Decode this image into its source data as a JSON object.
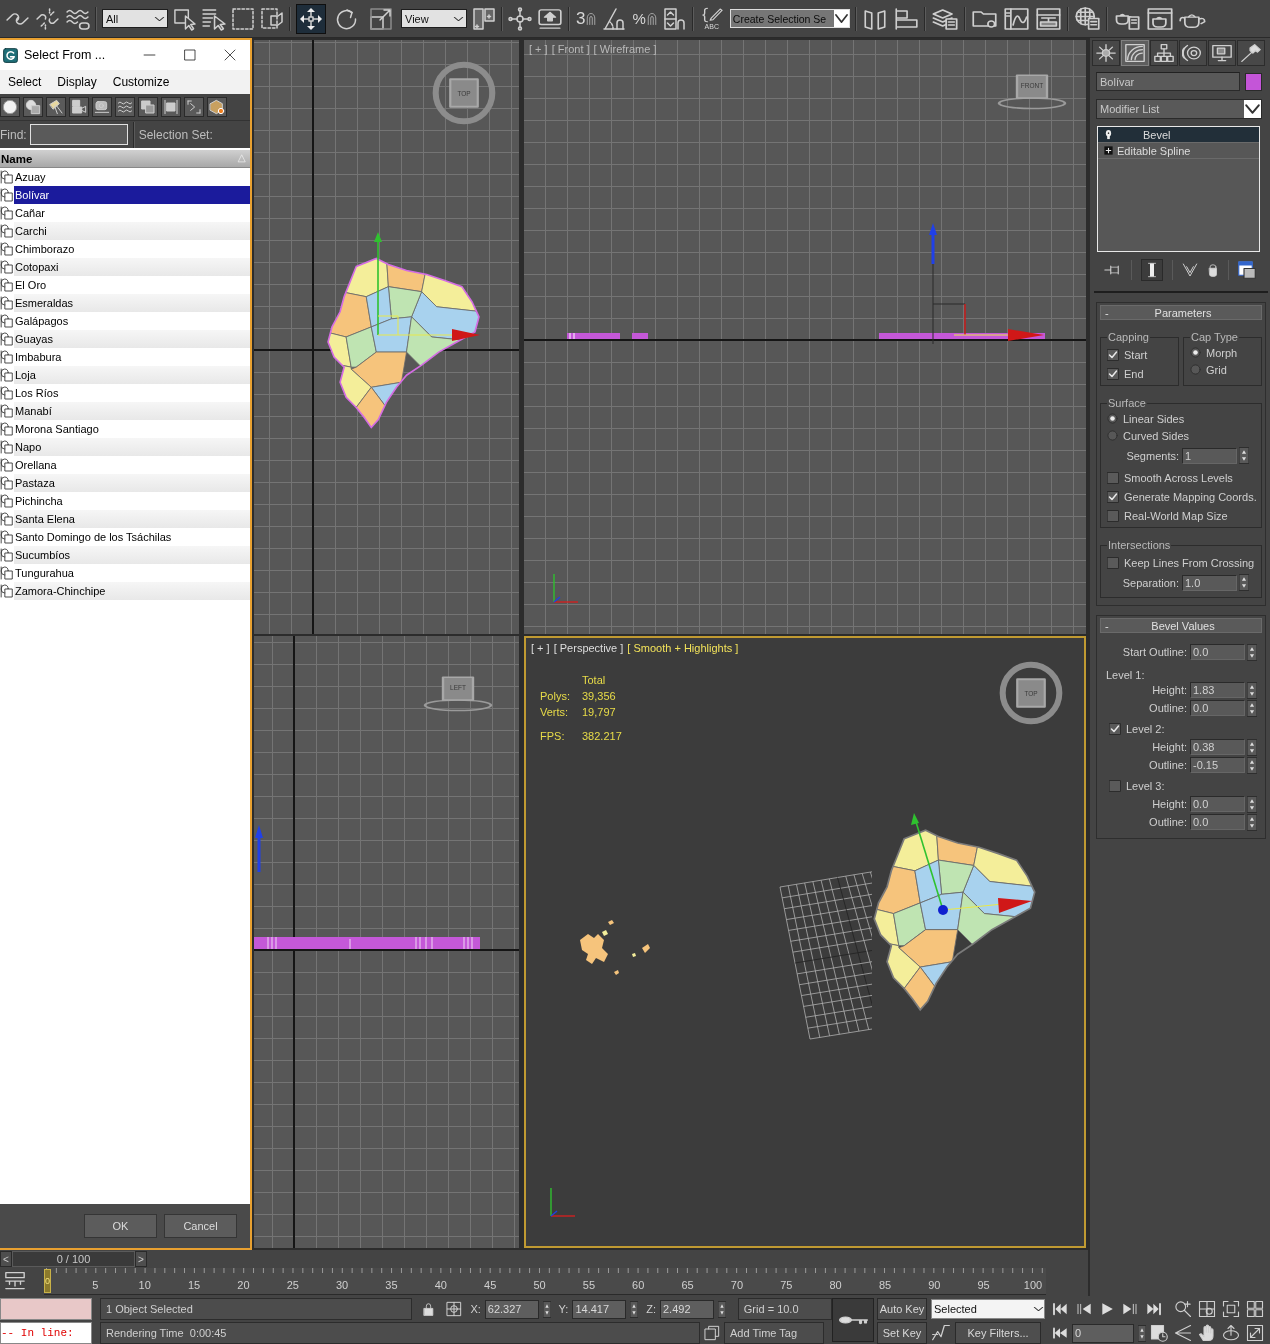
{
  "toolbar": {
    "selection_filter": "All",
    "transform_tools": [
      {
        "selected": true
      },
      {
        "selected": false
      },
      {
        "selected": false
      }
    ],
    "reference_coordinate_system": "View",
    "snaps_toggle_label": "3",
    "percent_snap_label": "%",
    "named_sets_label": "ABC",
    "named_selection_set": "Create Selection Se"
  },
  "dialog": {
    "title": "Select From ...",
    "menu": [
      "Select",
      "Display",
      "Customize"
    ],
    "find_label": "Find:",
    "selection_set_label": "Selection Set:",
    "column": "Name",
    "items": [
      {
        "name": "Azuay",
        "selected": false
      },
      {
        "name": "Bolívar",
        "selected": true
      },
      {
        "name": "Cañar",
        "selected": false
      },
      {
        "name": "Carchi",
        "selected": false
      },
      {
        "name": "Chimborazo",
        "selected": false
      },
      {
        "name": "Cotopaxi",
        "selected": false
      },
      {
        "name": "El Oro",
        "selected": false
      },
      {
        "name": "Esmeraldas",
        "selected": false
      },
      {
        "name": "Galápagos",
        "selected": false
      },
      {
        "name": "Guayas",
        "selected": false
      },
      {
        "name": "Imbabura",
        "selected": false
      },
      {
        "name": "Loja",
        "selected": false
      },
      {
        "name": "Los Ríos",
        "selected": false
      },
      {
        "name": "Manabí",
        "selected": false
      },
      {
        "name": "Morona Santiago",
        "selected": false
      },
      {
        "name": "Napo",
        "selected": false
      },
      {
        "name": "Orellana",
        "selected": false
      },
      {
        "name": "Pastaza",
        "selected": false
      },
      {
        "name": "Pichincha",
        "selected": false
      },
      {
        "name": "Santa Elena",
        "selected": false
      },
      {
        "name": "Santo Domingo de los Tsáchilas",
        "selected": false
      },
      {
        "name": "Sucumbíos",
        "selected": false
      },
      {
        "name": "Tungurahua",
        "selected": false
      },
      {
        "name": "Zamora-Chinchipe",
        "selected": false
      }
    ],
    "buttons": [
      "OK",
      "Cancel"
    ]
  },
  "viewports": [
    {
      "kind": "top",
      "active": false,
      "view_cube": "TOP"
    },
    {
      "kind": "front",
      "active": false,
      "label": [
        {
          "text": "[ + ]",
          "highlighted": false
        },
        {
          "text": "[ Front ]",
          "highlighted": false
        },
        {
          "text": "[ Wireframe ]",
          "highlighted": false
        }
      ],
      "view_cube": "FRONT"
    },
    {
      "kind": "left",
      "active": false,
      "view_cube": "LEFT"
    },
    {
      "kind": "perspective",
      "active": true,
      "label": [
        {
          "text": "[ + ]",
          "highlighted": false
        },
        {
          "text": "[ Perspective ]",
          "highlighted": false
        },
        {
          "text": "[ Smooth + Highlights ]",
          "highlighted": true
        }
      ],
      "view_cube": "TOP",
      "stats": {
        "header": "Total",
        "rows": [
          {
            "label": "Polys:",
            "value": "39,356"
          },
          {
            "label": "Verts:",
            "value": "19,797"
          }
        ],
        "fps_label": "FPS:",
        "fps": "382.217"
      }
    }
  ],
  "command_panel": {
    "tabs": [
      {
        "selected": false
      },
      {
        "selected": true
      },
      {
        "selected": false
      },
      {
        "selected": false
      },
      {
        "selected": false
      },
      {
        "selected": false
      }
    ],
    "object_name": "Bolívar",
    "modifier_list": "Modifier List",
    "stack": [
      {
        "name": "Bevel",
        "kind": "modifier",
        "selected": true
      },
      {
        "name": "Editable Spline",
        "kind": "base",
        "selected": false
      }
    ],
    "show_end_result": true,
    "rollouts": [
      {
        "toggle": "-",
        "title": "Parameters",
        "group_rows": [
          {
            "groups": [
              {
                "title": "Capping",
                "rows": [
                  {
                    "kind": "checkbox",
                    "label": "Start",
                    "checked": true
                  },
                  {
                    "kind": "checkbox",
                    "label": "End",
                    "checked": true
                  }
                ]
              },
              {
                "title": "Cap Type",
                "rows": [
                  {
                    "kind": "radio",
                    "label": "Morph",
                    "selected": true
                  },
                  {
                    "kind": "radio",
                    "label": "Grid",
                    "selected": false
                  }
                ]
              }
            ]
          },
          {
            "groups": [
              {
                "title": "Surface",
                "rows": [
                  {
                    "kind": "radio",
                    "label": "Linear Sides",
                    "selected": true
                  },
                  {
                    "kind": "radio",
                    "label": "Curved Sides",
                    "selected": false
                  },
                  {
                    "kind": "spinner",
                    "label": "Segments:",
                    "value": "1"
                  },
                  {
                    "kind": "checkbox",
                    "label": "Smooth Across Levels",
                    "checked": false
                  },
                  {
                    "kind": "checkbox",
                    "label": "Generate Mapping Coords.",
                    "checked": true
                  },
                  {
                    "kind": "checkbox",
                    "label": "Real-World Map Size",
                    "checked": false
                  }
                ]
              }
            ]
          },
          {
            "groups": [
              {
                "title": "Intersections",
                "rows": [
                  {
                    "kind": "checkbox",
                    "label": "Keep Lines From Crossing",
                    "checked": false
                  },
                  {
                    "kind": "spinner",
                    "label": "Separation:",
                    "value": "1.0"
                  }
                ]
              }
            ]
          }
        ]
      },
      {
        "toggle": "-",
        "title": "Bevel Values",
        "rows": [
          {
            "kind": "spinner",
            "label": "Start Outline:",
            "value": "0.0"
          },
          {
            "kind": "label",
            "label": "Level 1:"
          },
          {
            "kind": "spinner",
            "label": "Height:",
            "value": "1.83"
          },
          {
            "kind": "spinner",
            "label": "Outline:",
            "value": "0.0"
          },
          {
            "kind": "checkbox",
            "label": "Level 2:",
            "checked": true
          },
          {
            "kind": "spinner",
            "label": "Height:",
            "value": "0.38"
          },
          {
            "kind": "spinner",
            "label": "Outline:",
            "value": "-0.15"
          },
          {
            "kind": "checkbox",
            "label": "Level 3:",
            "checked": false
          },
          {
            "kind": "spinner",
            "label": "Height:",
            "value": "0.0"
          },
          {
            "kind": "spinner",
            "label": "Outline:",
            "value": "0.0"
          }
        ]
      }
    ]
  },
  "time_slider": {
    "previous": "<",
    "position": "0 / 100",
    "next": ">"
  },
  "track_bar": {
    "current_frame": "0",
    "ticks": [
      "5",
      "10",
      "15",
      "20",
      "25",
      "30",
      "35",
      "40",
      "45",
      "50",
      "55",
      "60",
      "65",
      "70",
      "75",
      "80",
      "85",
      "90",
      "95",
      "100"
    ]
  },
  "status_bar": {
    "listener_output": "-- In line:",
    "prompt": "1 Object Selected",
    "status": "Rendering Time  0:00:45",
    "coordinates": [
      {
        "label": "X:",
        "value": "62.327"
      },
      {
        "label": "Y:",
        "value": "14.417"
      },
      {
        "label": "Z:",
        "value": "2.492"
      }
    ],
    "grid": "Grid = 10.0",
    "time_tag": "Add Time Tag",
    "auto_key": "Auto Key",
    "key_set": "Selected",
    "set_key": "Set Key",
    "key_filters": "Key Filters...",
    "frame": "0"
  }
}
